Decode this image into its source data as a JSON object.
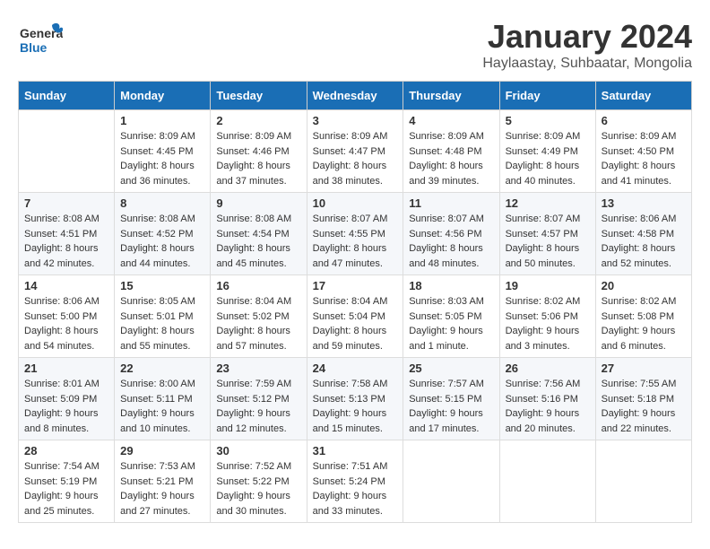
{
  "logo": {
    "line1": "General",
    "line2": "Blue"
  },
  "title": "January 2024",
  "location": "Haylaastay, Suhbaatar, Mongolia",
  "days_of_week": [
    "Sunday",
    "Monday",
    "Tuesday",
    "Wednesday",
    "Thursday",
    "Friday",
    "Saturday"
  ],
  "weeks": [
    [
      {
        "day": "",
        "content": ""
      },
      {
        "day": "1",
        "content": "Sunrise: 8:09 AM\nSunset: 4:45 PM\nDaylight: 8 hours\nand 36 minutes."
      },
      {
        "day": "2",
        "content": "Sunrise: 8:09 AM\nSunset: 4:46 PM\nDaylight: 8 hours\nand 37 minutes."
      },
      {
        "day": "3",
        "content": "Sunrise: 8:09 AM\nSunset: 4:47 PM\nDaylight: 8 hours\nand 38 minutes."
      },
      {
        "day": "4",
        "content": "Sunrise: 8:09 AM\nSunset: 4:48 PM\nDaylight: 8 hours\nand 39 minutes."
      },
      {
        "day": "5",
        "content": "Sunrise: 8:09 AM\nSunset: 4:49 PM\nDaylight: 8 hours\nand 40 minutes."
      },
      {
        "day": "6",
        "content": "Sunrise: 8:09 AM\nSunset: 4:50 PM\nDaylight: 8 hours\nand 41 minutes."
      }
    ],
    [
      {
        "day": "7",
        "content": "Sunrise: 8:08 AM\nSunset: 4:51 PM\nDaylight: 8 hours\nand 42 minutes."
      },
      {
        "day": "8",
        "content": "Sunrise: 8:08 AM\nSunset: 4:52 PM\nDaylight: 8 hours\nand 44 minutes."
      },
      {
        "day": "9",
        "content": "Sunrise: 8:08 AM\nSunset: 4:54 PM\nDaylight: 8 hours\nand 45 minutes."
      },
      {
        "day": "10",
        "content": "Sunrise: 8:07 AM\nSunset: 4:55 PM\nDaylight: 8 hours\nand 47 minutes."
      },
      {
        "day": "11",
        "content": "Sunrise: 8:07 AM\nSunset: 4:56 PM\nDaylight: 8 hours\nand 48 minutes."
      },
      {
        "day": "12",
        "content": "Sunrise: 8:07 AM\nSunset: 4:57 PM\nDaylight: 8 hours\nand 50 minutes."
      },
      {
        "day": "13",
        "content": "Sunrise: 8:06 AM\nSunset: 4:58 PM\nDaylight: 8 hours\nand 52 minutes."
      }
    ],
    [
      {
        "day": "14",
        "content": "Sunrise: 8:06 AM\nSunset: 5:00 PM\nDaylight: 8 hours\nand 54 minutes."
      },
      {
        "day": "15",
        "content": "Sunrise: 8:05 AM\nSunset: 5:01 PM\nDaylight: 8 hours\nand 55 minutes."
      },
      {
        "day": "16",
        "content": "Sunrise: 8:04 AM\nSunset: 5:02 PM\nDaylight: 8 hours\nand 57 minutes."
      },
      {
        "day": "17",
        "content": "Sunrise: 8:04 AM\nSunset: 5:04 PM\nDaylight: 8 hours\nand 59 minutes."
      },
      {
        "day": "18",
        "content": "Sunrise: 8:03 AM\nSunset: 5:05 PM\nDaylight: 9 hours\nand 1 minute."
      },
      {
        "day": "19",
        "content": "Sunrise: 8:02 AM\nSunset: 5:06 PM\nDaylight: 9 hours\nand 3 minutes."
      },
      {
        "day": "20",
        "content": "Sunrise: 8:02 AM\nSunset: 5:08 PM\nDaylight: 9 hours\nand 6 minutes."
      }
    ],
    [
      {
        "day": "21",
        "content": "Sunrise: 8:01 AM\nSunset: 5:09 PM\nDaylight: 9 hours\nand 8 minutes."
      },
      {
        "day": "22",
        "content": "Sunrise: 8:00 AM\nSunset: 5:11 PM\nDaylight: 9 hours\nand 10 minutes."
      },
      {
        "day": "23",
        "content": "Sunrise: 7:59 AM\nSunset: 5:12 PM\nDaylight: 9 hours\nand 12 minutes."
      },
      {
        "day": "24",
        "content": "Sunrise: 7:58 AM\nSunset: 5:13 PM\nDaylight: 9 hours\nand 15 minutes."
      },
      {
        "day": "25",
        "content": "Sunrise: 7:57 AM\nSunset: 5:15 PM\nDaylight: 9 hours\nand 17 minutes."
      },
      {
        "day": "26",
        "content": "Sunrise: 7:56 AM\nSunset: 5:16 PM\nDaylight: 9 hours\nand 20 minutes."
      },
      {
        "day": "27",
        "content": "Sunrise: 7:55 AM\nSunset: 5:18 PM\nDaylight: 9 hours\nand 22 minutes."
      }
    ],
    [
      {
        "day": "28",
        "content": "Sunrise: 7:54 AM\nSunset: 5:19 PM\nDaylight: 9 hours\nand 25 minutes."
      },
      {
        "day": "29",
        "content": "Sunrise: 7:53 AM\nSunset: 5:21 PM\nDaylight: 9 hours\nand 27 minutes."
      },
      {
        "day": "30",
        "content": "Sunrise: 7:52 AM\nSunset: 5:22 PM\nDaylight: 9 hours\nand 30 minutes."
      },
      {
        "day": "31",
        "content": "Sunrise: 7:51 AM\nSunset: 5:24 PM\nDaylight: 9 hours\nand 33 minutes."
      },
      {
        "day": "",
        "content": ""
      },
      {
        "day": "",
        "content": ""
      },
      {
        "day": "",
        "content": ""
      }
    ]
  ]
}
